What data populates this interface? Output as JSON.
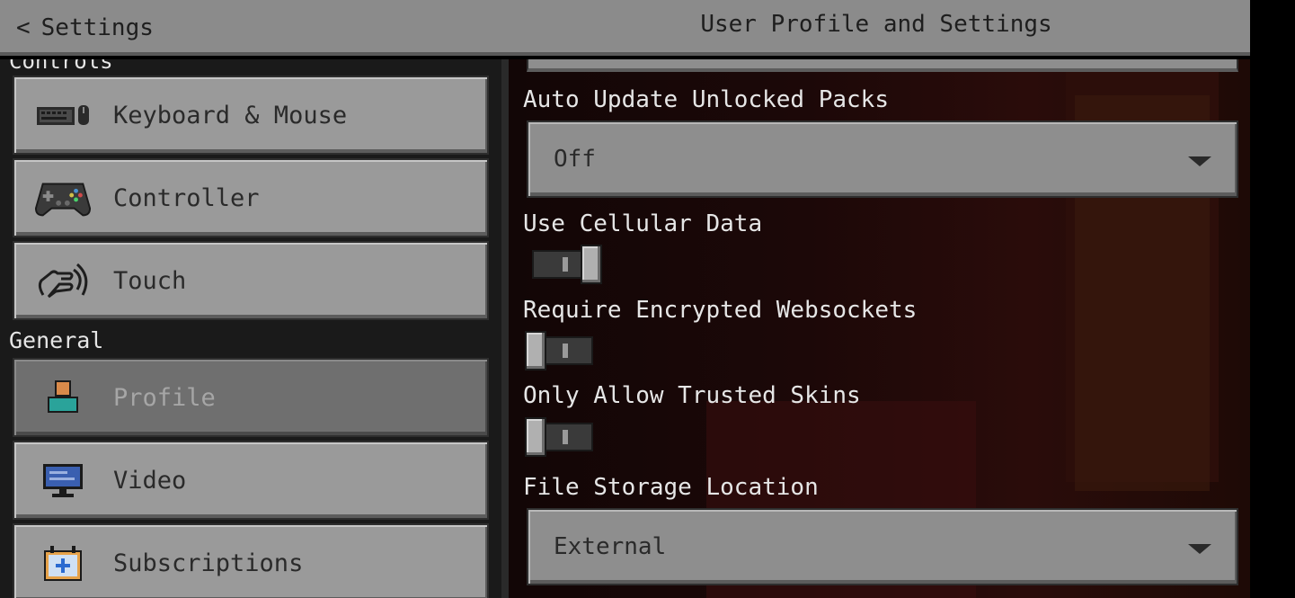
{
  "header": {
    "back_label": "Settings",
    "title": "User Profile and Settings"
  },
  "sidebar": {
    "cut_section": "Controls",
    "section_general": "General",
    "items": [
      {
        "label": "Keyboard & Mouse",
        "icon": "keyboard-mouse-icon"
      },
      {
        "label": "Controller",
        "icon": "controller-icon"
      },
      {
        "label": "Touch",
        "icon": "touch-icon"
      },
      {
        "label": "Profile",
        "icon": "profile-icon",
        "selected": true
      },
      {
        "label": "Video",
        "icon": "monitor-icon"
      },
      {
        "label": "Subscriptions",
        "icon": "subscriptions-icon"
      }
    ]
  },
  "settings": {
    "auto_update": {
      "label": "Auto Update Unlocked Packs",
      "value": "Off"
    },
    "cellular": {
      "label": "Use Cellular Data",
      "on": true
    },
    "websockets": {
      "label": "Require Encrypted Websockets",
      "on": false
    },
    "trusted_skins": {
      "label": "Only Allow Trusted Skins",
      "on": false
    },
    "storage": {
      "label": "File Storage Location",
      "value": "External"
    }
  },
  "colors": {
    "header_bg": "#8b8b8b",
    "button_bg": "#9a9a9a",
    "selected_bg": "#6f6f6f",
    "profile_accent": "#2aa39a",
    "profile_head": "#d98a4a"
  }
}
